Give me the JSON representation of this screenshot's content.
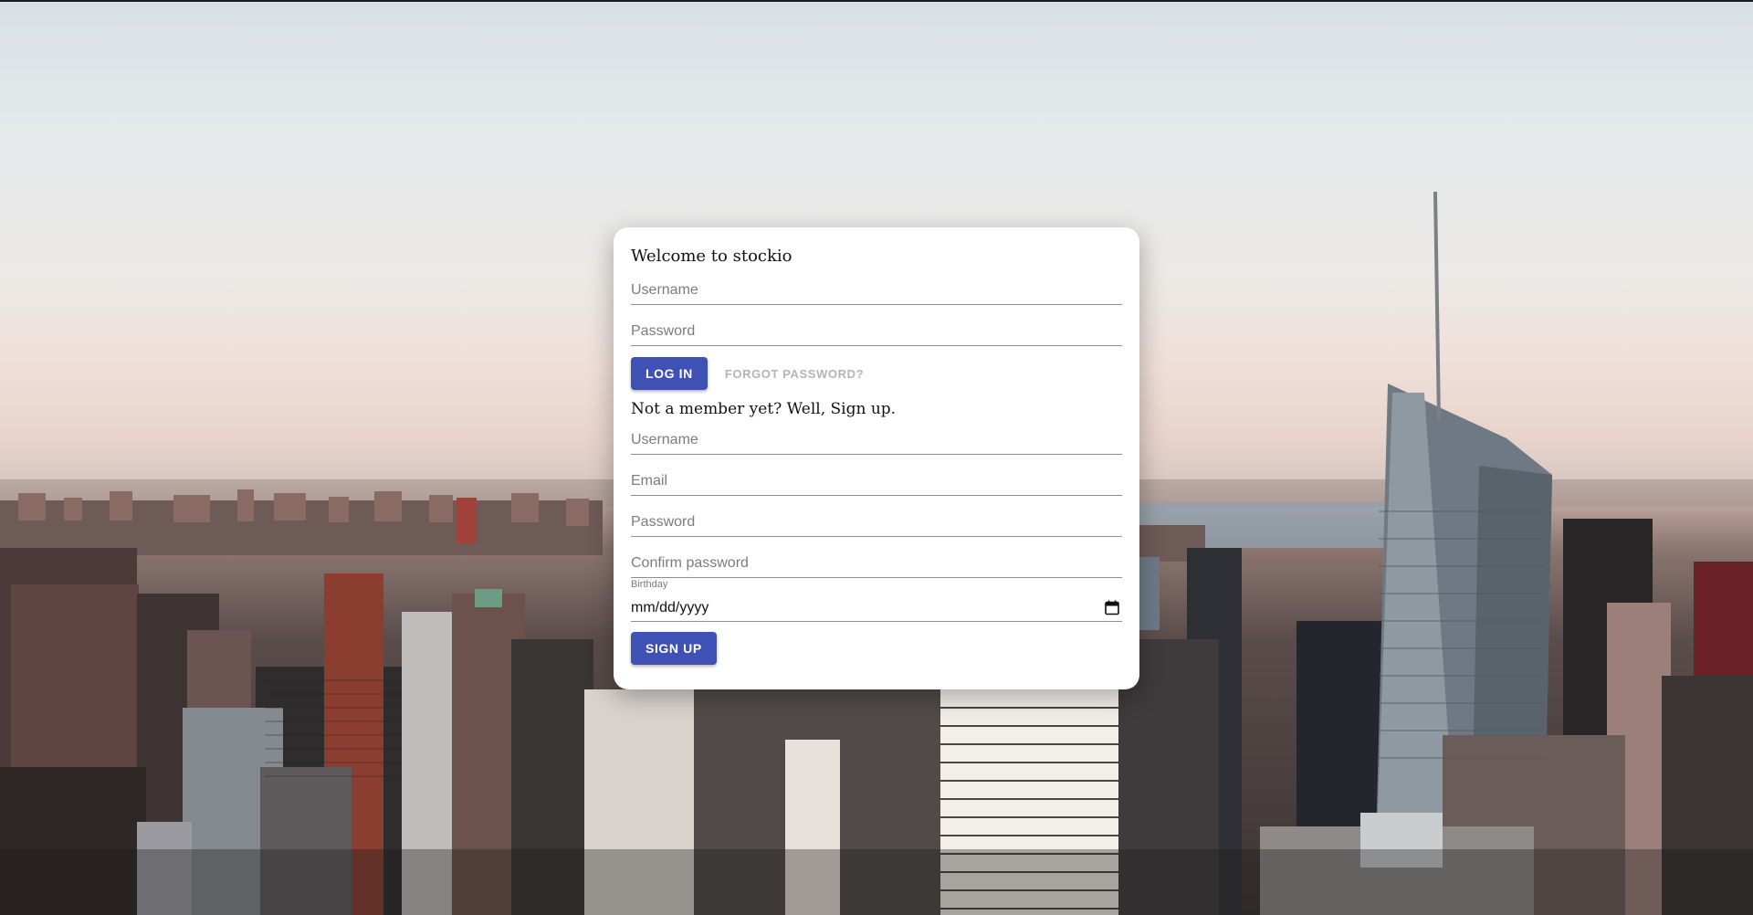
{
  "login": {
    "title": "Welcome to stockio",
    "username_placeholder": "Username",
    "password_placeholder": "Password",
    "login_button": "LOG IN",
    "forgot_button": "FORGOT PASSWORD?"
  },
  "signup": {
    "title": "Not a member yet? Well, Sign up.",
    "username_placeholder": "Username",
    "email_placeholder": "Email",
    "password_placeholder": "Password",
    "confirm_placeholder": "Confirm password",
    "birthday_label": "Birthday",
    "birthday_value": "mm/dd/yyyy",
    "signup_button": "SIGN UP"
  },
  "colors": {
    "primary": "#3f51b5",
    "card": "#ffffff",
    "link_disabled": "#b4b4b4"
  },
  "icons": {
    "calendar": "calendar-icon"
  }
}
